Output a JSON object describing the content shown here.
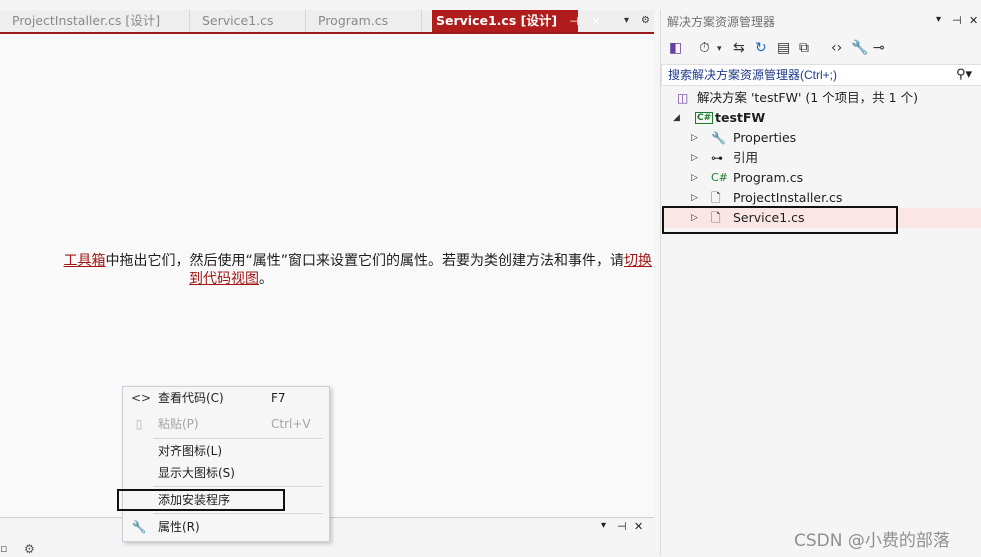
{
  "tabs": [
    {
      "label": "ProjectInstaller.cs [设计]"
    },
    {
      "label": "Service1.cs"
    },
    {
      "label": "Program.cs"
    },
    {
      "label": "Service1.cs [设计]",
      "active": true
    }
  ],
  "tab_pin_glyph": "⊣",
  "tab_close_glyph": "✕",
  "tab_overflow_glyph": "▾",
  "tab_settings_glyph": "⚙",
  "designer": {
    "msg_link1": "工具箱",
    "msg_text": "中拖出它们，然后使用“属性”窗口来设置它们的属性。若要为类创建方法和事件，请",
    "msg_link2_a": "切换",
    "msg_link2_b": "到代码视图",
    "msg_end": "。"
  },
  "context_menu": {
    "items": [
      {
        "icon": "<>",
        "label": "查看代码(C)",
        "shortcut": "F7"
      },
      {
        "icon": "📋",
        "label": "粘贴(P)",
        "shortcut": "Ctrl+V",
        "disabled": true
      },
      {
        "icon": "",
        "label": "对齐图标(L)",
        "shortcut": ""
      },
      {
        "icon": "",
        "label": "显示大图标(S)",
        "shortcut": ""
      },
      {
        "icon": "",
        "label": "添加安装程序",
        "shortcut": ""
      },
      {
        "icon": "🔧",
        "label": "属性(R)",
        "shortcut": ""
      }
    ]
  },
  "bottom_panel": {
    "dropdown_glyph": "▾",
    "pin_glyph": "⊣",
    "close_glyph": "✕"
  },
  "solution_explorer": {
    "title": "解决方案资源管理器",
    "search_placeholder": "搜索解决方案资源管理器(Ctrl+;)",
    "search_glyph": "⚲▾",
    "solution": "解决方案 'testFW' (1 个项目，共 1 个)",
    "project": "testFW",
    "items": [
      {
        "label": "Properties",
        "icon": "wrench-icon"
      },
      {
        "label": "引用",
        "icon": "references-icon"
      },
      {
        "label": "Program.cs",
        "icon": "csharp-icon"
      },
      {
        "label": "ProjectInstaller.cs",
        "icon": "component-file-icon"
      },
      {
        "label": "Service1.cs",
        "icon": "component-file-icon",
        "selected": true
      }
    ]
  },
  "watermark": "CSDN @小费的部落",
  "colors": {
    "accent": "#b01c1c",
    "link": "#a31515",
    "selection": "#fbe6e6"
  }
}
